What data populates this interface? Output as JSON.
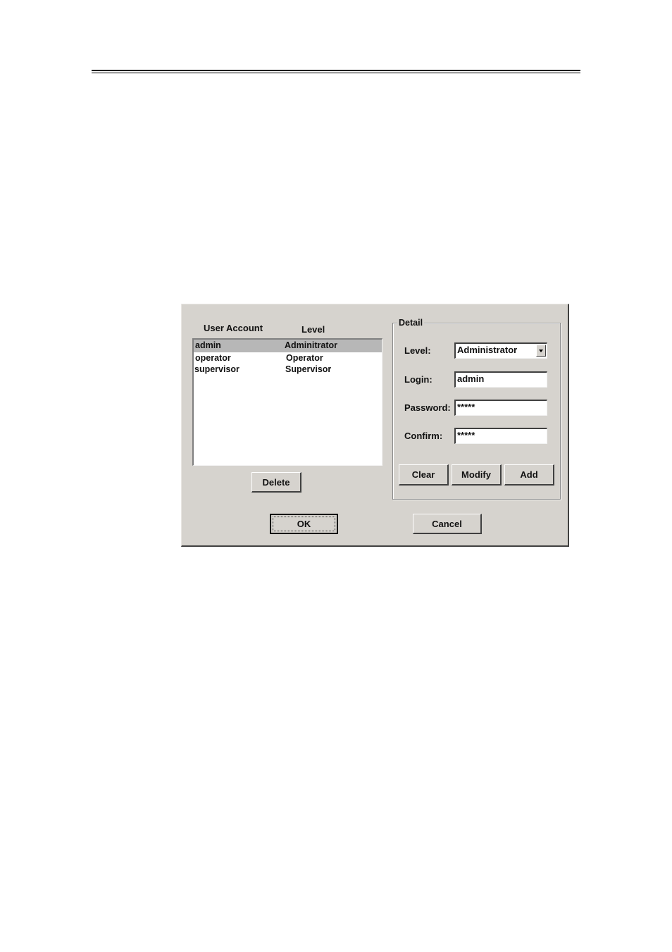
{
  "dialog": {
    "user_list": {
      "headers": {
        "account": "User Account",
        "level": "Level"
      },
      "rows": [
        {
          "account": "admin",
          "level": "Adminitrator",
          "selected": true
        },
        {
          "account": "operator",
          "level": "Operator",
          "selected": false
        },
        {
          "account": "supervisor",
          "level": "Supervisor",
          "selected": false
        }
      ],
      "delete_label": "Delete"
    },
    "detail": {
      "title": "Detail",
      "level_label": "Level:",
      "level_value": "Administrator",
      "login_label": "Login:",
      "login_value": "admin",
      "password_label": "Password:",
      "password_value": "*****",
      "confirm_label": "Confirm:",
      "confirm_value": "*****",
      "clear_label": "Clear",
      "modify_label": "Modify",
      "add_label": "Add"
    },
    "ok_label": "OK",
    "cancel_label": "Cancel"
  },
  "colors": {
    "dialog_bg": "#d6d3ce",
    "selection_bg": "#b7b7b7"
  }
}
